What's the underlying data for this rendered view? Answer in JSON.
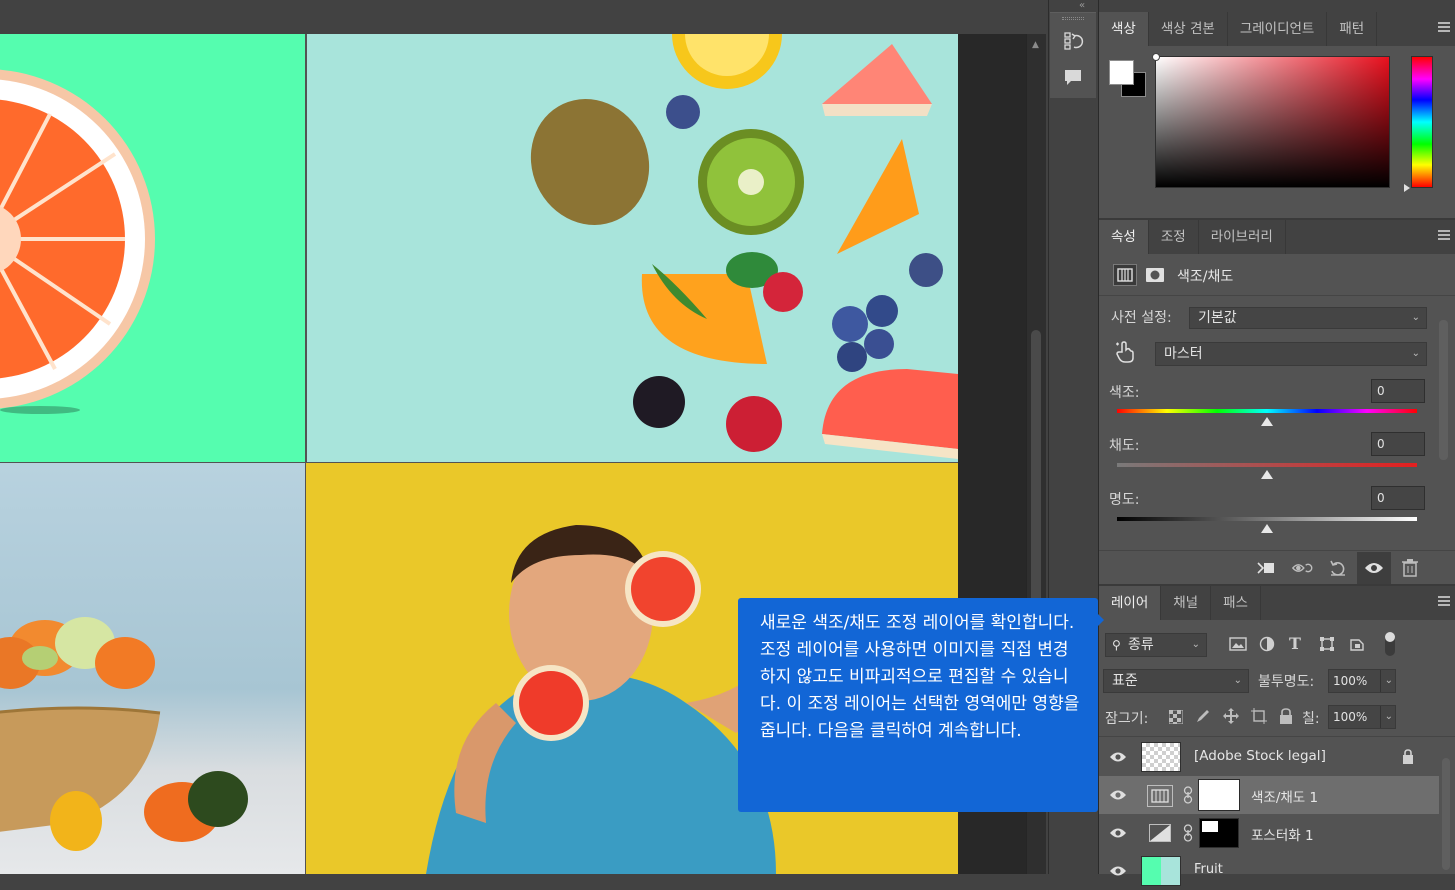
{
  "colors": {
    "callout_bg": "#1266d6",
    "panel_bg": "#535353",
    "tab_bar_bg": "#424242",
    "selected_layer_bg": "#6e6e6e"
  },
  "canvas": {
    "quadrants": [
      {
        "name": "grapefruit-on-green"
      },
      {
        "name": "fruit-pieces-on-teal"
      },
      {
        "name": "fruit-bowl"
      },
      {
        "name": "boy-with-grapefruit"
      }
    ]
  },
  "callout": {
    "text": "새로운 색조/채도 조정 레이어를 확인합니다. 조정 레이어를 사용하면 이미지를 직접 변경하지 않고도 비파괴적으로 편집할 수 있습니다. 이 조정 레이어는 선택한 영역에만 영향을 줍니다. 다음을 클릭하여 계속합니다."
  },
  "side_tools": {
    "icons": [
      "history-icon",
      "comment-icon"
    ]
  },
  "color_panel": {
    "tabs": [
      {
        "label": "색상",
        "active": true
      },
      {
        "label": "색상 견본",
        "active": false
      },
      {
        "label": "그레이디언트",
        "active": false
      },
      {
        "label": "패턴",
        "active": false
      }
    ],
    "foreground": "#ffffff",
    "background": "#000000"
  },
  "properties_panel": {
    "tabs": [
      {
        "label": "속성",
        "active": true
      },
      {
        "label": "조정",
        "active": false
      },
      {
        "label": "라이브러리",
        "active": false
      }
    ],
    "adjustment_title": "색조/채도",
    "preset_label": "사전 설정:",
    "preset_value": "기본값",
    "channel_value": "마스터",
    "hue": {
      "label": "색조:",
      "value": "0"
    },
    "saturation": {
      "label": "채도:",
      "value": "0"
    },
    "lightness": {
      "label": "명도:",
      "value": "0"
    }
  },
  "layers_panel": {
    "tabs": [
      {
        "label": "레이어",
        "active": true
      },
      {
        "label": "채널",
        "active": false
      },
      {
        "label": "패스",
        "active": false
      }
    ],
    "filter_kind": "종류",
    "blend_mode": "표준",
    "opacity_label": "불투명도:",
    "opacity_value": "100%",
    "lock_label": "잠그기:",
    "fill_label": "칠:",
    "fill_value": "100%",
    "layers": [
      {
        "name": "[Adobe Stock legal]",
        "locked": true,
        "selected": false
      },
      {
        "name": "색조/채도 1",
        "locked": false,
        "selected": true
      },
      {
        "name": "포스터화 1",
        "locked": false,
        "selected": false
      },
      {
        "name": "Fruit",
        "locked": false,
        "selected": false
      }
    ]
  }
}
